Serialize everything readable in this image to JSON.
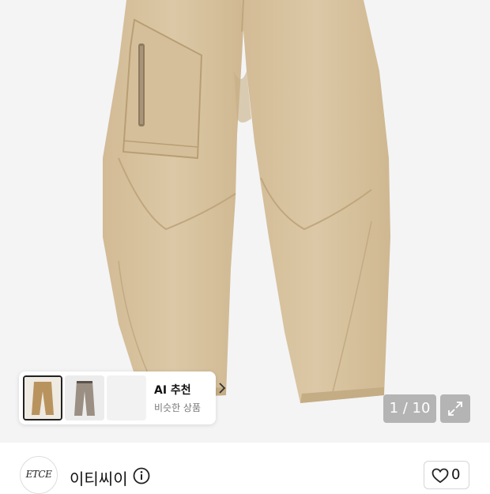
{
  "product_image": {
    "alt": "beige wide pants",
    "colors": {
      "pants": "#d9c4a2",
      "background": "#f4f4f5"
    }
  },
  "recommend": {
    "title": "AI 추천",
    "subtitle": "비슷한 상품",
    "thumbnails": [
      "beige-pants",
      "gray-pants",
      "empty"
    ]
  },
  "gallery": {
    "counter": "1 / 10"
  },
  "shop": {
    "logo_text": "ETCE",
    "name": "이티씨이"
  },
  "like": {
    "count": "0"
  }
}
